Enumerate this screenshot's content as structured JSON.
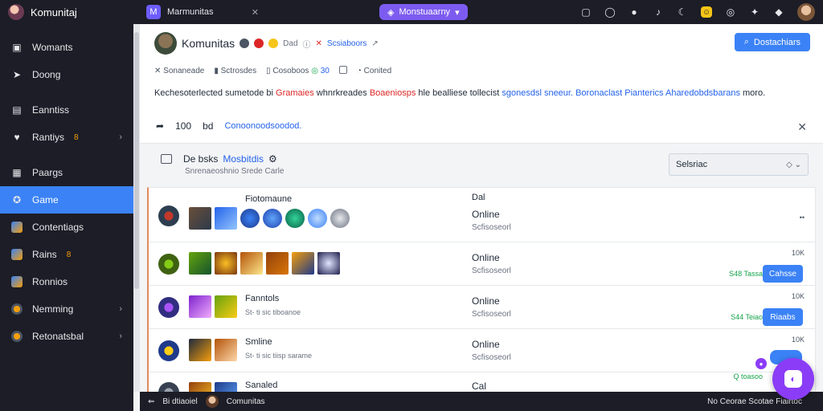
{
  "topbar": {
    "brand": "Komunitaj",
    "tab_label": "Marmunitas",
    "pill_label": "Monstuaarny",
    "icons": [
      "bookmark-icon",
      "chat-icon",
      "notification-icon",
      "mute-icon",
      "moon-icon",
      "emoji-icon",
      "gamepad-icon",
      "ticket-icon",
      "diamond-icon",
      "avatar"
    ]
  },
  "sidebar": {
    "items": [
      {
        "label": "Womants",
        "icon": "wallet-icon"
      },
      {
        "label": "Doong",
        "icon": "pin-icon"
      },
      {
        "label": "Eanntiss",
        "icon": "store-icon"
      },
      {
        "label": "Rantiys",
        "icon": "heart-icon",
        "badge": "8",
        "chevron": true
      },
      {
        "label": "Paargs",
        "icon": "calendar-icon"
      },
      {
        "label": "Game",
        "icon": "gamepad-icon",
        "active": true
      },
      {
        "label": "Contentiags",
        "icon": "image-icon"
      },
      {
        "label": "Rains",
        "icon": "trophy-icon",
        "badge": "8"
      },
      {
        "label": "Ronnios",
        "icon": "cube-icon"
      },
      {
        "label": "Nemming",
        "icon": "avatar-icon",
        "chevron": true
      },
      {
        "label": "Retonatsbal",
        "icon": "globe-icon",
        "chevron": true
      }
    ]
  },
  "community": {
    "name": "Komunitas",
    "tag_small": "Dad",
    "tag_red": "✕",
    "tag_link": "Scsiaboors",
    "join_button": "Dostachiars",
    "meta": {
      "item1": "Sonaneade",
      "item2": "Sctrosdes",
      "item3": "Cosoboos",
      "item4": "30",
      "item5": "Conited"
    },
    "description": {
      "part1": "Kechesoterlected sumetode bi",
      "part2": "Gramaies",
      "part3": "whnrkreades",
      "part4": "Boaeniosps",
      "part5": "hle bealliese tollecist",
      "part6": "sgonesdsl sneeur.",
      "part7": "Boronaclast Pianterics Aharedobdsbarans",
      "part8": "moro."
    },
    "reactions": {
      "count1": "100",
      "count2": "bd",
      "link": "Conoonoodsoodod."
    }
  },
  "panel": {
    "title": "De bsks",
    "title_link": "Mosbitdis",
    "subtitle": "Snrenaeoshnio Srede Carle",
    "select_value": "Selsriac"
  },
  "rows": [
    {
      "title": "Fiotomaune",
      "subtitle": "",
      "header_status": "Dal",
      "status": "Online",
      "status_sub": "Scfisoseorl",
      "pct": "••",
      "gain": "",
      "action": ""
    },
    {
      "title": "",
      "subtitle": "",
      "status": "Online",
      "status_sub": "Scfisoseorl",
      "pct": "10K",
      "gain": "S48 Tassa",
      "action": "Cahsse"
    },
    {
      "title": "Fanntols",
      "subtitle": "St- ti sic tiboanoe",
      "status": "Online",
      "status_sub": "Scfisoseorl",
      "pct": "10K",
      "gain": "S44 Teiao",
      "action": "Riaabs"
    },
    {
      "title": "Smline",
      "subtitle": "St- ti sic tiisp sarame",
      "status": "Online",
      "status_sub": "Scfisoseorl",
      "pct": "10K",
      "gain": "",
      "action": ""
    },
    {
      "title": "Sanaled",
      "subtitle": "",
      "status": "Cal",
      "status_sub": "",
      "pct": "",
      "gain": "Q toasoo",
      "action": ""
    }
  ],
  "bottombar": {
    "left1": "Bi dtiaoiel",
    "left2": "Comunitas",
    "right": "No Ceorae Scotae Fiairtoc"
  }
}
